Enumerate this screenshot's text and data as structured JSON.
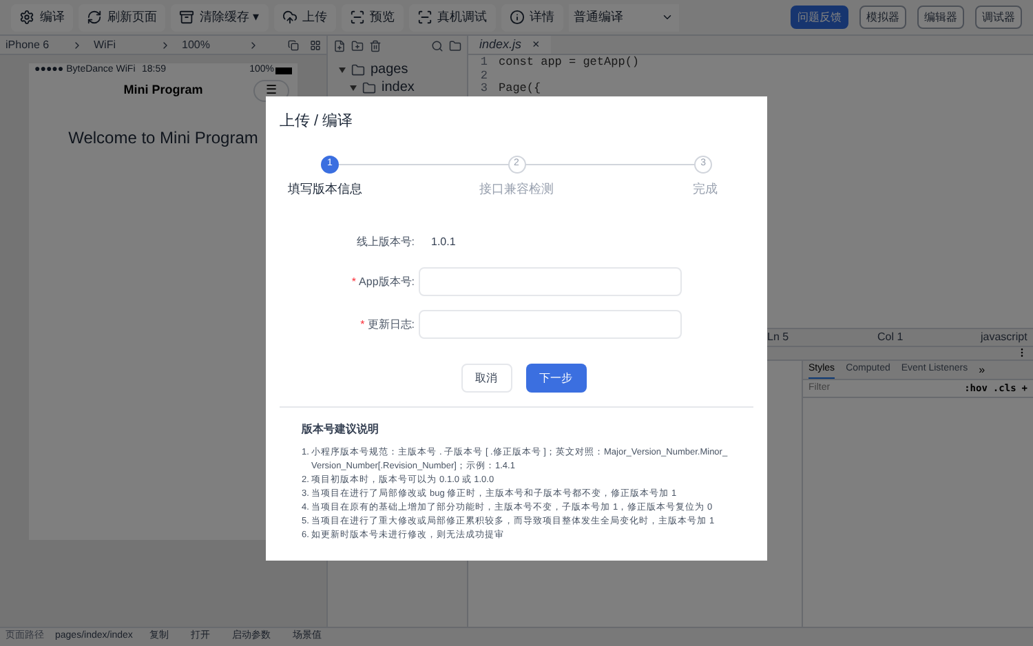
{
  "toolbar": {
    "tools": [
      {
        "label": "编译",
        "kind": "gear"
      },
      {
        "label": "刷新页面",
        "kind": "refresh"
      },
      {
        "label": "清除缓存 ▾",
        "kind": "box"
      },
      {
        "label": "上传",
        "kind": "upload"
      },
      {
        "label": "预览",
        "kind": "preview"
      },
      {
        "label": "真机调试",
        "kind": "preview"
      },
      {
        "label": "详情",
        "kind": "info"
      }
    ],
    "compile_mode": "普通编译",
    "right_buttons": [
      {
        "label": "问题反馈",
        "primary": true
      },
      {
        "label": "模拟器",
        "primary": false
      },
      {
        "label": "编辑器",
        "primary": false
      },
      {
        "label": "调试器",
        "primary": false
      }
    ]
  },
  "device_bar": {
    "items": [
      "iPhone 6",
      "WiFi",
      "100%"
    ]
  },
  "simulator": {
    "carrier": "●●●●● ByteDance WiFi",
    "time": "18:59",
    "battery": "100%",
    "nav_title": "Mini Program",
    "menu": "☰",
    "content": "Welcome to Mini Program"
  },
  "file_tree": [
    {
      "label": "pages",
      "children": [
        {
          "label": "index"
        }
      ]
    }
  ],
  "editor": {
    "tab": "index.js",
    "close": "×",
    "lines": [
      {
        "number": "1",
        "code": "const app = getApp()"
      },
      {
        "number": "2"
      },
      {
        "number": "3",
        "code": "Page({"
      }
    ],
    "status": [
      "Ln 5",
      "Col 1",
      "javascript"
    ]
  },
  "devtools": {
    "tabs": [
      {
        "label": "Styles",
        "selected": true
      },
      {
        "label": "Computed",
        "selected": false
      },
      {
        "label": "Event Listeners",
        "selected": false
      }
    ],
    "more": "»",
    "filter_placeholder": "Filter",
    "actions": [
      ":hov",
      ".cls",
      "+"
    ]
  },
  "bottom_bar": {
    "path_label": "页面路径",
    "path": "pages/index/index",
    "actions": [
      "复制",
      "打开",
      "启动参数",
      "场景值"
    ]
  },
  "dialog": {
    "title": "上传 / 编译",
    "steps": [
      {
        "number": "1",
        "label": "填写版本信息",
        "selected": true
      },
      {
        "number": "2",
        "label": "接口兼容检测",
        "selected": false
      },
      {
        "number": "3",
        "label": "完成",
        "selected": false
      }
    ],
    "online_version": {
      "label": "线上版本号:",
      "value": "1.0.1"
    },
    "fields": [
      {
        "label": "App版本号:",
        "required_mark": "*"
      },
      {
        "label": "更新日志:",
        "required_mark": "*"
      }
    ],
    "cancel": "取消",
    "next": "下一步",
    "notes_title": "版本号建议说明",
    "notes": [
      "1. 小程序版本号规范：主版本号 . 子版本号 [ .修正版本号 ]；英文对照：Major_Version_Number.Minor_Version_Number[.Revision_Number]；示例：1.4.1",
      "2. 项目初版本时，版本号可以为 0.1.0 或 1.0.0",
      "3. 当项目在进行了局部修改或 bug 修正时，主版本号和子版本号都不变，修正版本号加 1",
      "4. 当项目在原有的基础上增加了部分功能时，主版本号不变，子版本号加 1，修正版本号复位为 0",
      "5. 当项目在进行了重大修改或局部修正累积较多，而导致项目整体发生全局变化时，主版本号加 1",
      "6. 如更新时版本号未进行修改，则无法成功提审"
    ]
  }
}
